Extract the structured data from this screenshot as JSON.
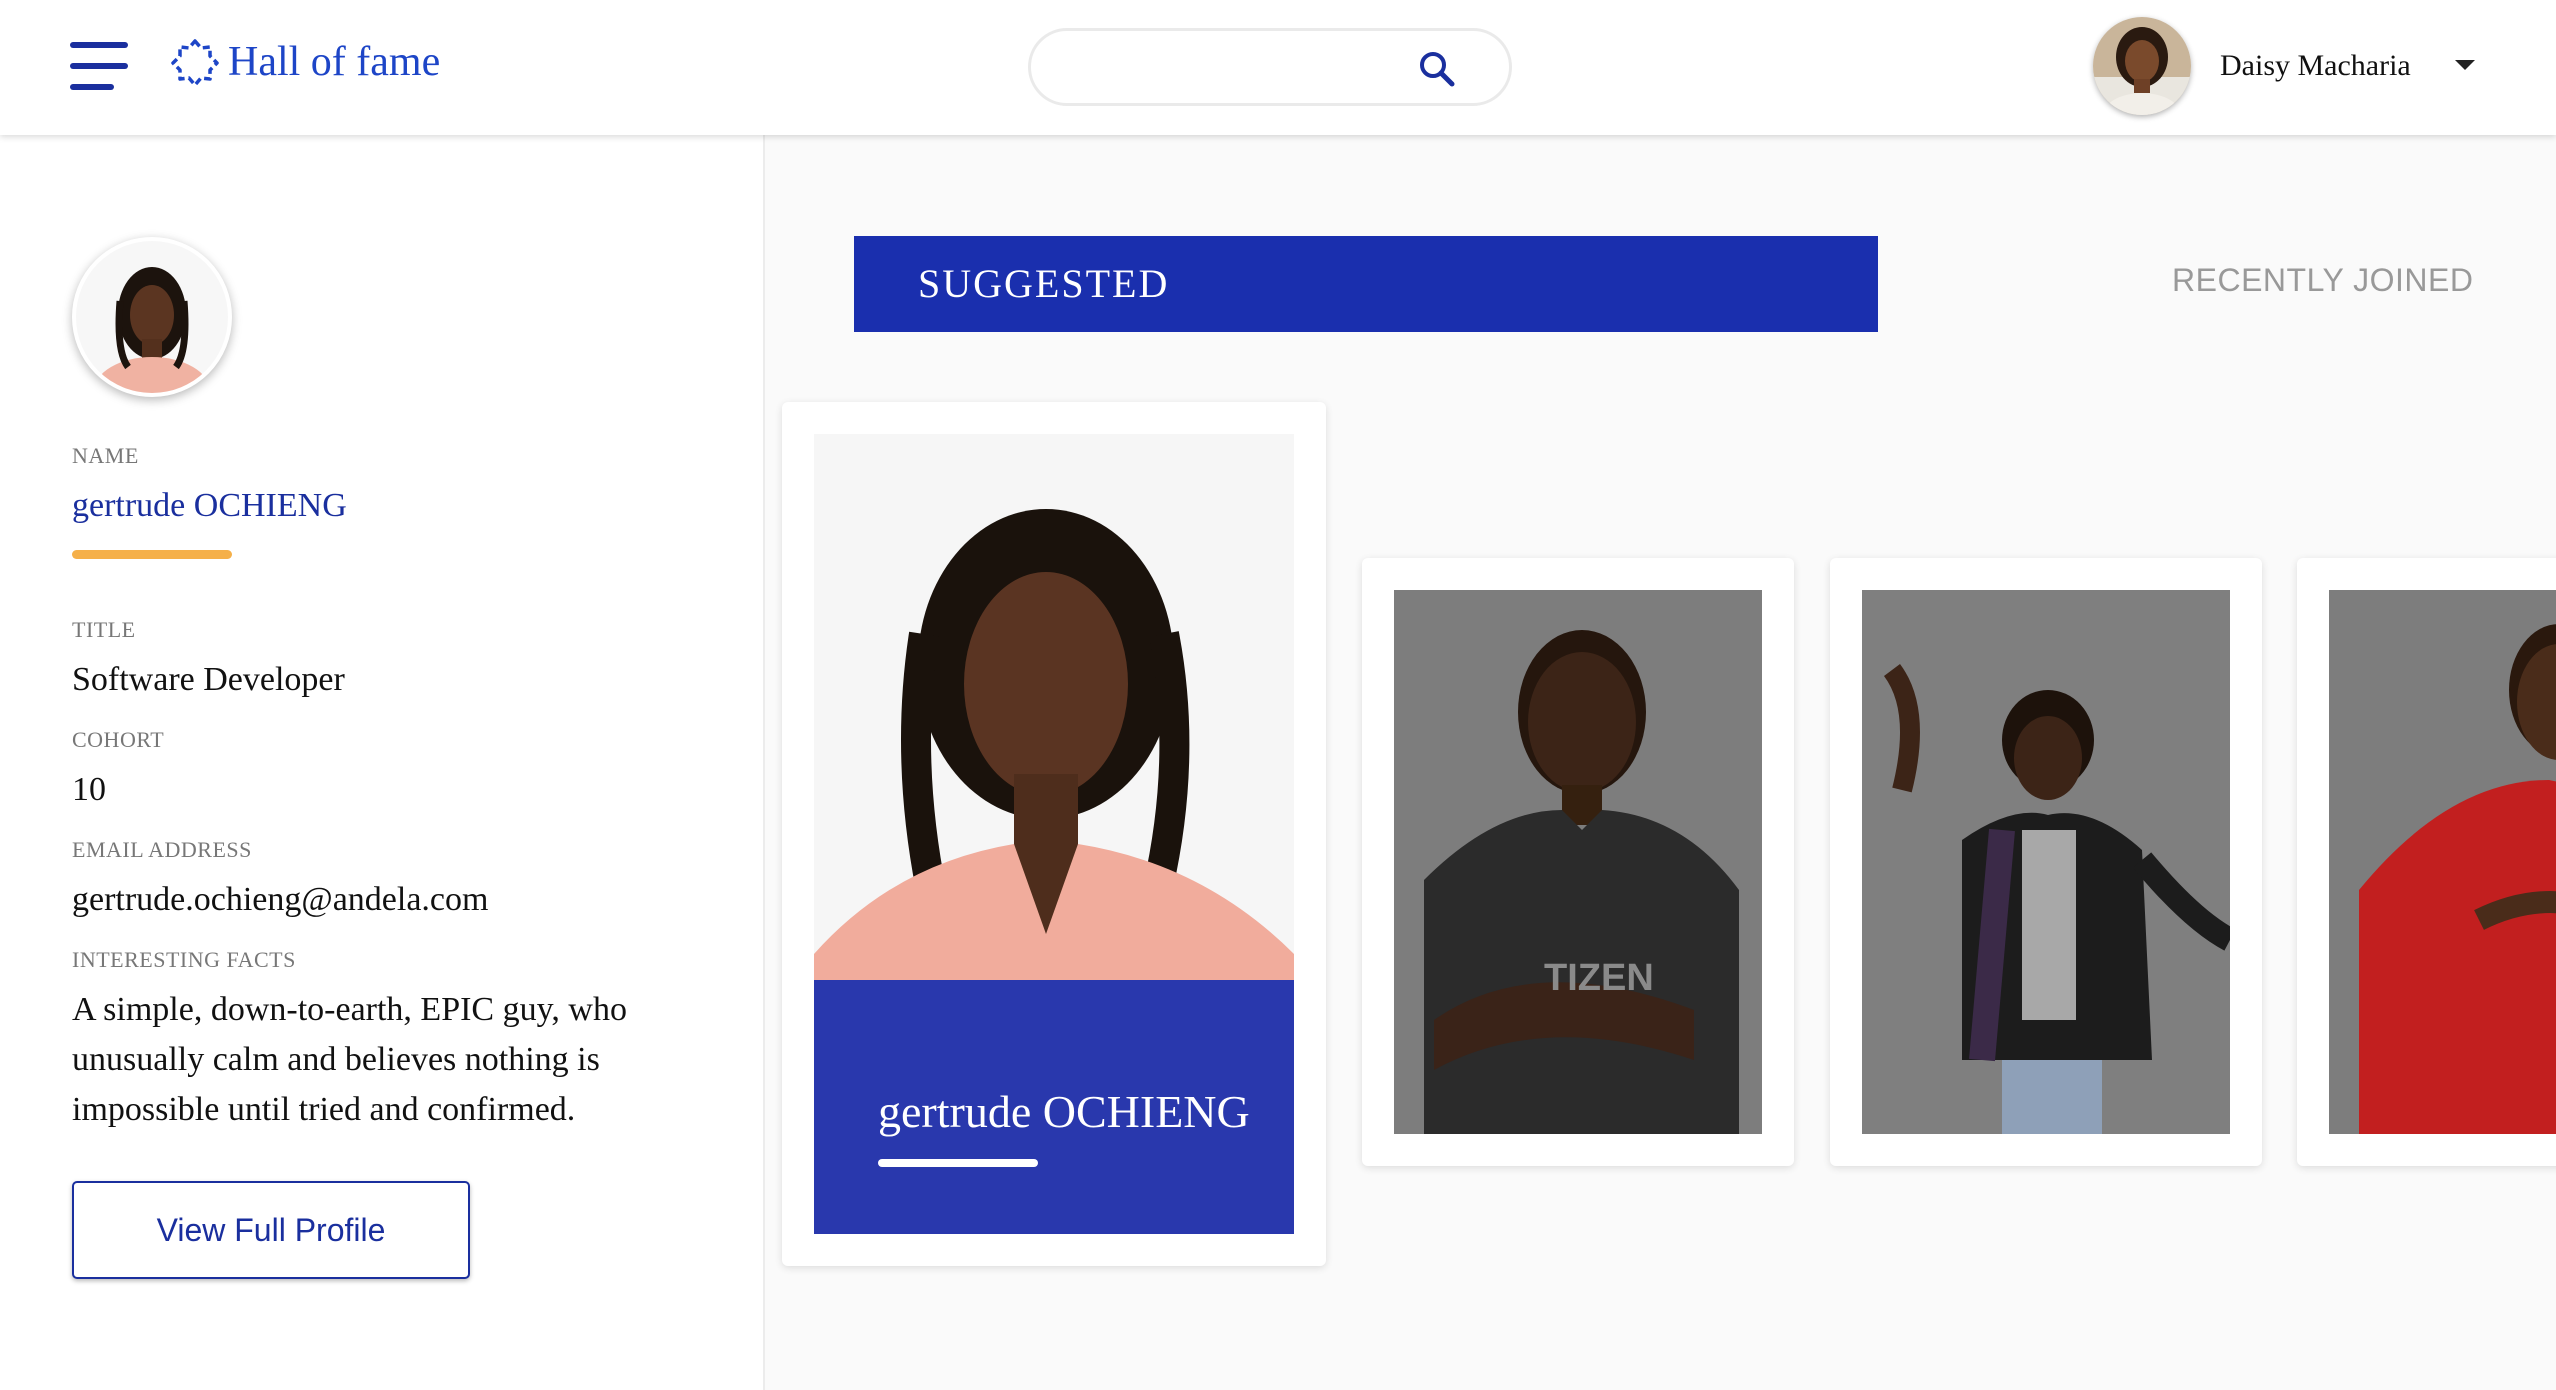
{
  "header": {
    "app_title": "Hall of fame",
    "search_placeholder": "",
    "user_name": "Daisy Macharia"
  },
  "profile": {
    "name_label": "NAME",
    "name": "gertrude OCHIENG",
    "title_label": "TITLE",
    "title": "Software Developer",
    "cohort_label": "COHORT",
    "cohort": "10",
    "email_label": "EMAIL ADDRESS",
    "email": "gertrude.ochieng@andela.com",
    "facts_label": "INTERESTING FACTS",
    "facts": "A simple, down-to-earth, EPIC guy, who unusually calm and believes nothing is impossible until tried and confirmed.",
    "view_profile_label": "View Full Profile"
  },
  "tabs": {
    "suggested": "SUGGESTED",
    "recent": "RECENTLY JOINED"
  },
  "cards": {
    "featured_name": "gertrude OCHIENG",
    "shirt_text": "TIZEN"
  },
  "colors": {
    "primary": "#1a2fae",
    "accent": "#f5b04a",
    "muted": "#999999"
  }
}
